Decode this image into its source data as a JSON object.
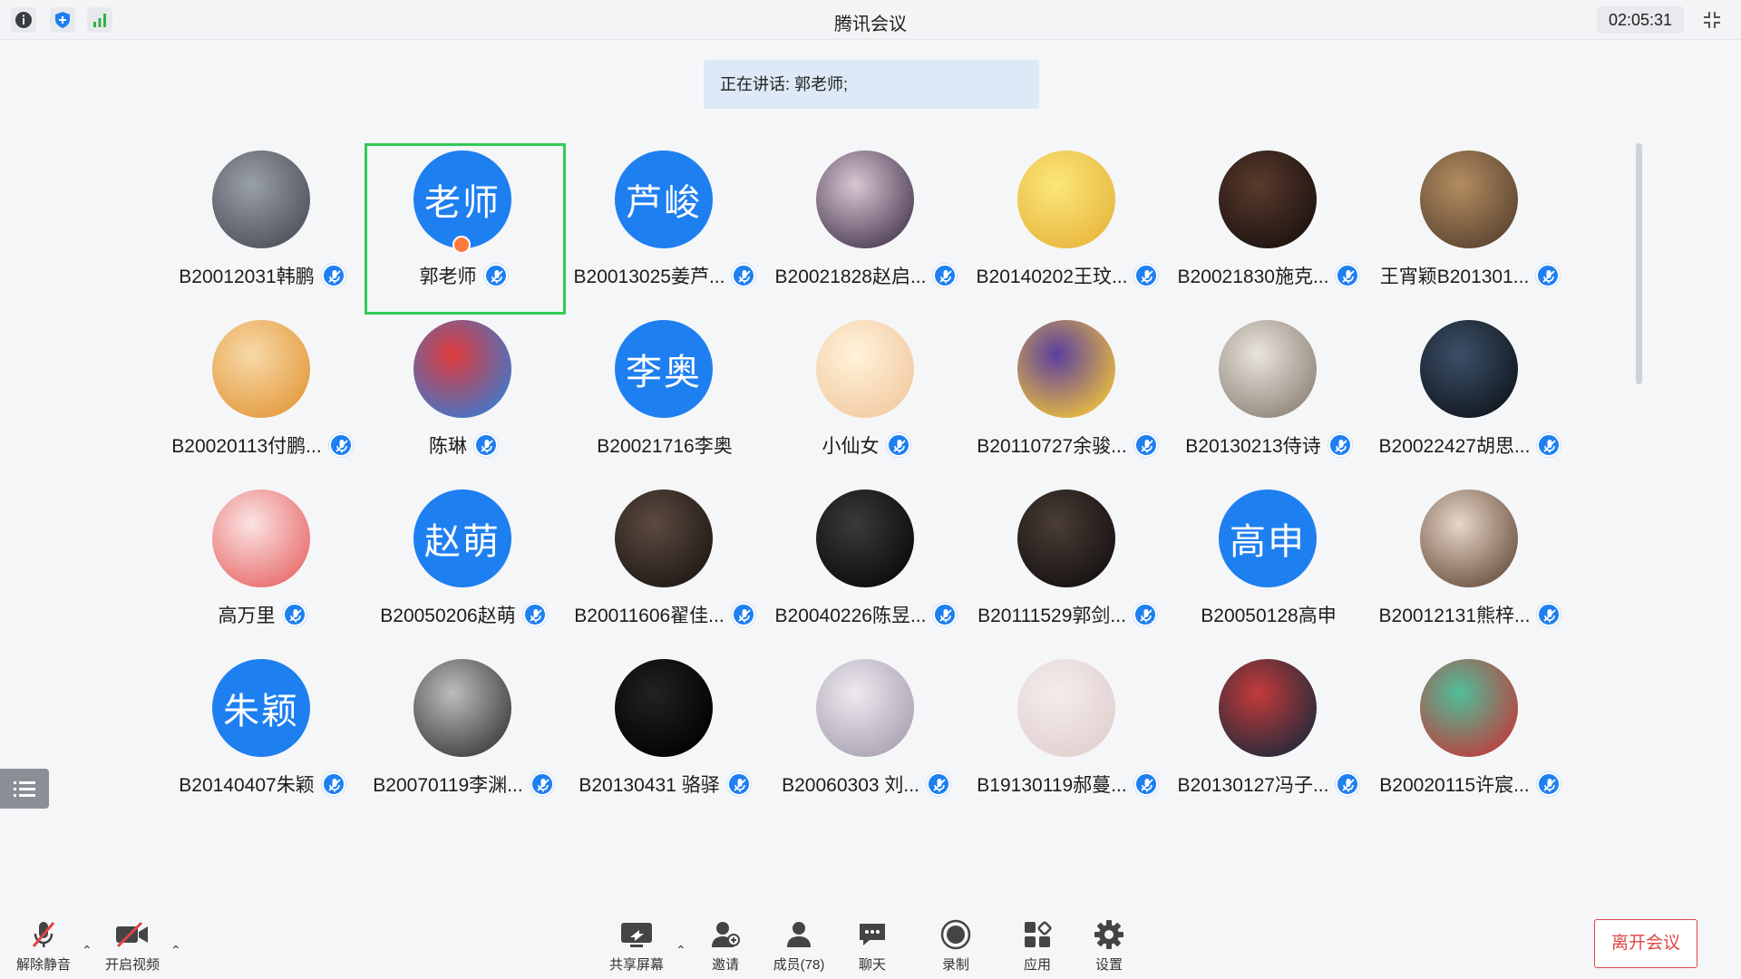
{
  "app": {
    "title": "腾讯会议",
    "clock": "02:05:31"
  },
  "top_icons": [
    "info-icon",
    "shield-icon",
    "signal-icon",
    "fullscreen-exit-icon"
  ],
  "speaking": {
    "text": "正在讲话: 郭老师;"
  },
  "participants": [
    {
      "name": "B20012031韩鹏",
      "avatar": "photo",
      "colors": [
        "#9aa0a8",
        "#4c5058"
      ]
    },
    {
      "name": "郭老师",
      "avatar": "text",
      "initials": "老师",
      "host": true,
      "selected": true
    },
    {
      "name": "B20013025姜芦...",
      "avatar": "text",
      "initials": "芦峻"
    },
    {
      "name": "B20021828赵启...",
      "avatar": "photo",
      "colors": [
        "#d8c6d2",
        "#4a3a52"
      ]
    },
    {
      "name": "B20140202王玟...",
      "avatar": "photo",
      "colors": [
        "#fbe77a",
        "#e8b63d"
      ]
    },
    {
      "name": "B20021830施克...",
      "avatar": "photo",
      "colors": [
        "#5a3a2c",
        "#1b1210"
      ]
    },
    {
      "name": "王宵颖B201301...",
      "avatar": "photo",
      "colors": [
        "#b38d60",
        "#5a4330"
      ]
    },
    {
      "name": "B20020113付鹏...",
      "avatar": "photo",
      "colors": [
        "#f7d9a8",
        "#e39a3c"
      ]
    },
    {
      "name": "陈琳",
      "avatar": "photo",
      "colors": [
        "#e03a3a",
        "#3a7ad0"
      ]
    },
    {
      "name": "B20021716李奥",
      "avatar": "text",
      "initials": "李奥",
      "no_mic": true
    },
    {
      "name": "小仙女",
      "avatar": "photo",
      "colors": [
        "#fff3da",
        "#f2c9a0"
      ]
    },
    {
      "name": "B20110727余骏...",
      "avatar": "photo",
      "colors": [
        "#5b3fa0",
        "#f0c23a"
      ]
    },
    {
      "name": "B20130213侍诗",
      "avatar": "photo",
      "colors": [
        "#e9e4dc",
        "#8e8478"
      ]
    },
    {
      "name": "B20022427胡思...",
      "avatar": "photo",
      "colors": [
        "#3c5068",
        "#10161e"
      ]
    },
    {
      "name": "高万里",
      "avatar": "photo",
      "colors": [
        "#fbe3e3",
        "#e86a6a"
      ]
    },
    {
      "name": "B20050206赵萌",
      "avatar": "text",
      "initials": "赵萌"
    },
    {
      "name": "B20011606翟佳...",
      "avatar": "photo",
      "colors": [
        "#5c4a40",
        "#1e1814"
      ]
    },
    {
      "name": "B20040226陈昱...",
      "avatar": "photo",
      "colors": [
        "#3a3a3a",
        "#0a0a0a"
      ]
    },
    {
      "name": "B20111529郭剑...",
      "avatar": "photo",
      "colors": [
        "#4a3d36",
        "#141010"
      ]
    },
    {
      "name": "B20050128高申",
      "avatar": "text",
      "initials": "高申",
      "no_mic": true
    },
    {
      "name": "B20012131熊梓...",
      "avatar": "photo",
      "colors": [
        "#e8d7c8",
        "#6a5040"
      ]
    },
    {
      "name": "B20140407朱颖",
      "avatar": "text",
      "initials": "朱颖"
    },
    {
      "name": "B20070119李渊...",
      "avatar": "photo",
      "colors": [
        "#bdbdbd",
        "#3c3c3c"
      ]
    },
    {
      "name": "B20130431 骆驿",
      "avatar": "photo",
      "colors": [
        "#222222",
        "#000000"
      ]
    },
    {
      "name": "B20060303 刘...",
      "avatar": "photo",
      "colors": [
        "#eeeaf0",
        "#a8a0b0"
      ]
    },
    {
      "name": "B19130119郝蔓...",
      "avatar": "photo",
      "colors": [
        "#f6ecec",
        "#e0d0d0"
      ]
    },
    {
      "name": "B20130127冯子...",
      "avatar": "photo",
      "colors": [
        "#c43a3a",
        "#1e2a3a"
      ]
    },
    {
      "name": "B20020115许宸...",
      "avatar": "photo",
      "colors": [
        "#4fbf9a",
        "#c03a3a"
      ]
    }
  ],
  "toolbar": {
    "unmute": "解除静音",
    "video": "开启视频",
    "share": "共享屏幕",
    "invite": "邀请",
    "members": "成员(78)",
    "chat": "聊天",
    "record": "录制",
    "apps": "应用",
    "settings": "设置",
    "leave": "离开会议"
  },
  "colors": {
    "accent": "#1e7ff0",
    "selected": "#2fcb58",
    "danger": "#e04545"
  }
}
